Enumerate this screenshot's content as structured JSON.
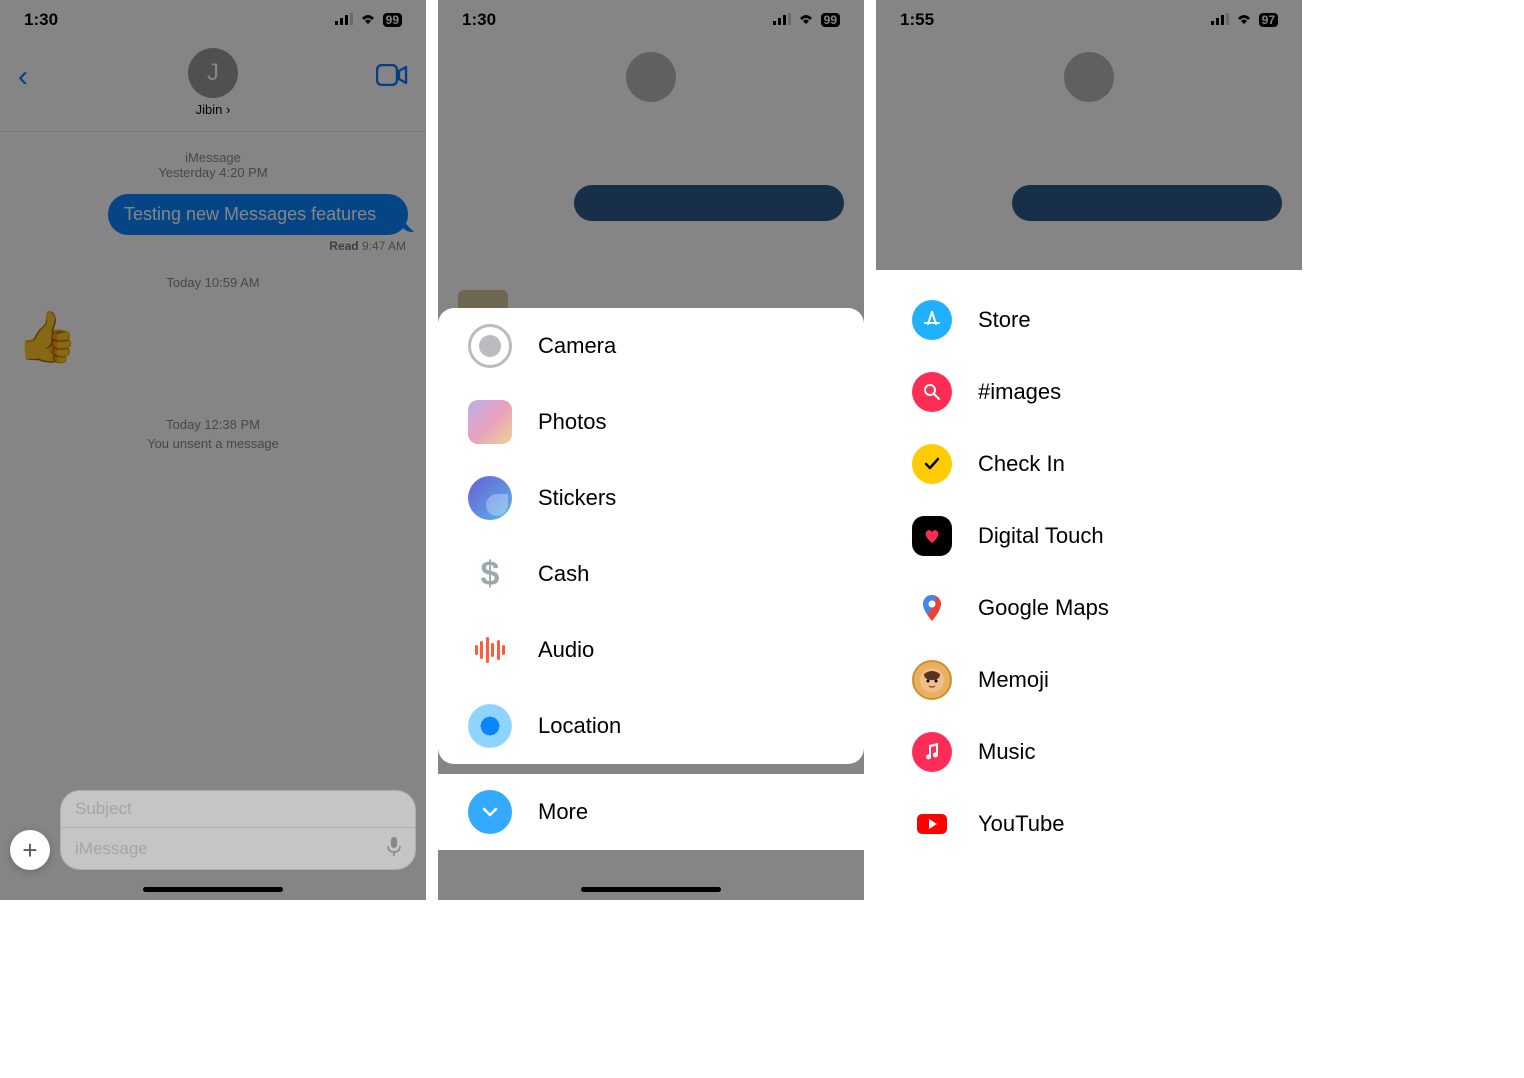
{
  "statusbar": {
    "times": [
      "1:30",
      "1:30",
      "1:55"
    ],
    "batteries": [
      "99",
      "99",
      "97"
    ]
  },
  "s1": {
    "back_label": "‹",
    "avatar_initial": "J",
    "contact_name": "Jibin ›",
    "meta_service": "iMessage",
    "meta_day_time": "Yesterday 4:20 PM",
    "bubble_text": "Testing new Messages features",
    "read_label": "Read",
    "read_time": "9:47 AM",
    "today1": "Today 10:59 AM",
    "emoji": "👍",
    "today2": "Today 12:38 PM",
    "unsent": "You unsent a message",
    "subject_placeholder": "Subject",
    "imessage_placeholder": "iMessage",
    "plus_label": "+"
  },
  "s2": {
    "items": [
      {
        "label": "Camera",
        "icon": "camera"
      },
      {
        "label": "Photos",
        "icon": "photos"
      },
      {
        "label": "Stickers",
        "icon": "stickers"
      },
      {
        "label": "Cash",
        "icon": "cash"
      },
      {
        "label": "Audio",
        "icon": "audio"
      },
      {
        "label": "Location",
        "icon": "location"
      }
    ],
    "more_label": "More"
  },
  "s3": {
    "items": [
      {
        "label": "Store",
        "icon": "store"
      },
      {
        "label": "#images",
        "icon": "images"
      },
      {
        "label": "Check In",
        "icon": "checkin"
      },
      {
        "label": "Digital Touch",
        "icon": "dtouch"
      },
      {
        "label": "Google Maps",
        "icon": "gmaps"
      },
      {
        "label": "Memoji",
        "icon": "memoji"
      },
      {
        "label": "Music",
        "icon": "music"
      },
      {
        "label": "YouTube",
        "icon": "youtube"
      }
    ]
  }
}
